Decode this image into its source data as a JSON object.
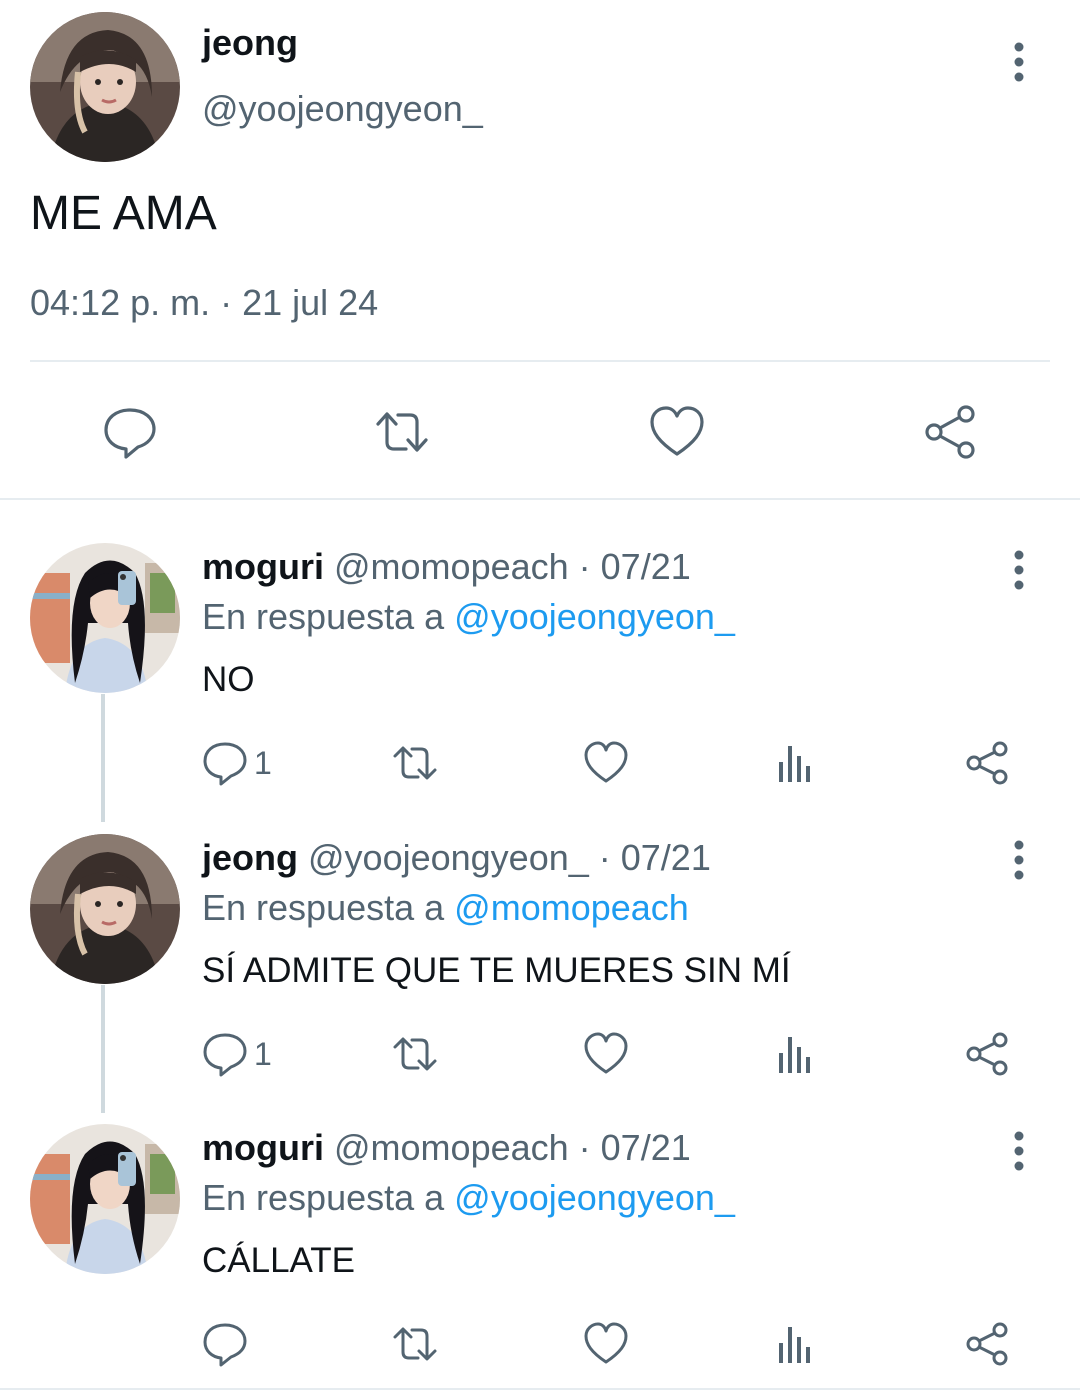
{
  "main_tweet": {
    "name": "jeong",
    "handle": "@yoojeongyeon_",
    "text": "ME AMA",
    "timestamp": "04:12 p. m. · 21 jul 24",
    "actions": [
      "reply-icon",
      "retweet-icon",
      "like-icon",
      "share-icon"
    ]
  },
  "replies": [
    {
      "name": "moguri",
      "handle_date": " @momopeach · 07/21",
      "reply_prefix": "En respuesta a ",
      "reply_mention": "@yoojeongyeon_",
      "text": "NO",
      "reply_count": "1"
    },
    {
      "name": "jeong",
      "handle_date": " @yoojeongyeon_ · 07/21",
      "reply_prefix": "En respuesta a ",
      "reply_mention": "@momopeach",
      "text": "SÍ ADMITE QUE TE MUERES SIN MÍ",
      "reply_count": "1"
    },
    {
      "name": "moguri",
      "handle_date": " @momopeach · 07/21",
      "reply_prefix": "En respuesta a ",
      "reply_mention": "@yoojeongyeon_",
      "text": "CÁLLATE",
      "reply_count": ""
    }
  ],
  "colors": {
    "primary_text": "#0f1419",
    "secondary_text": "#536471",
    "mention": "#1d9bf0",
    "divider": "#e6ecf0",
    "thread_line": "#cfd9de"
  }
}
